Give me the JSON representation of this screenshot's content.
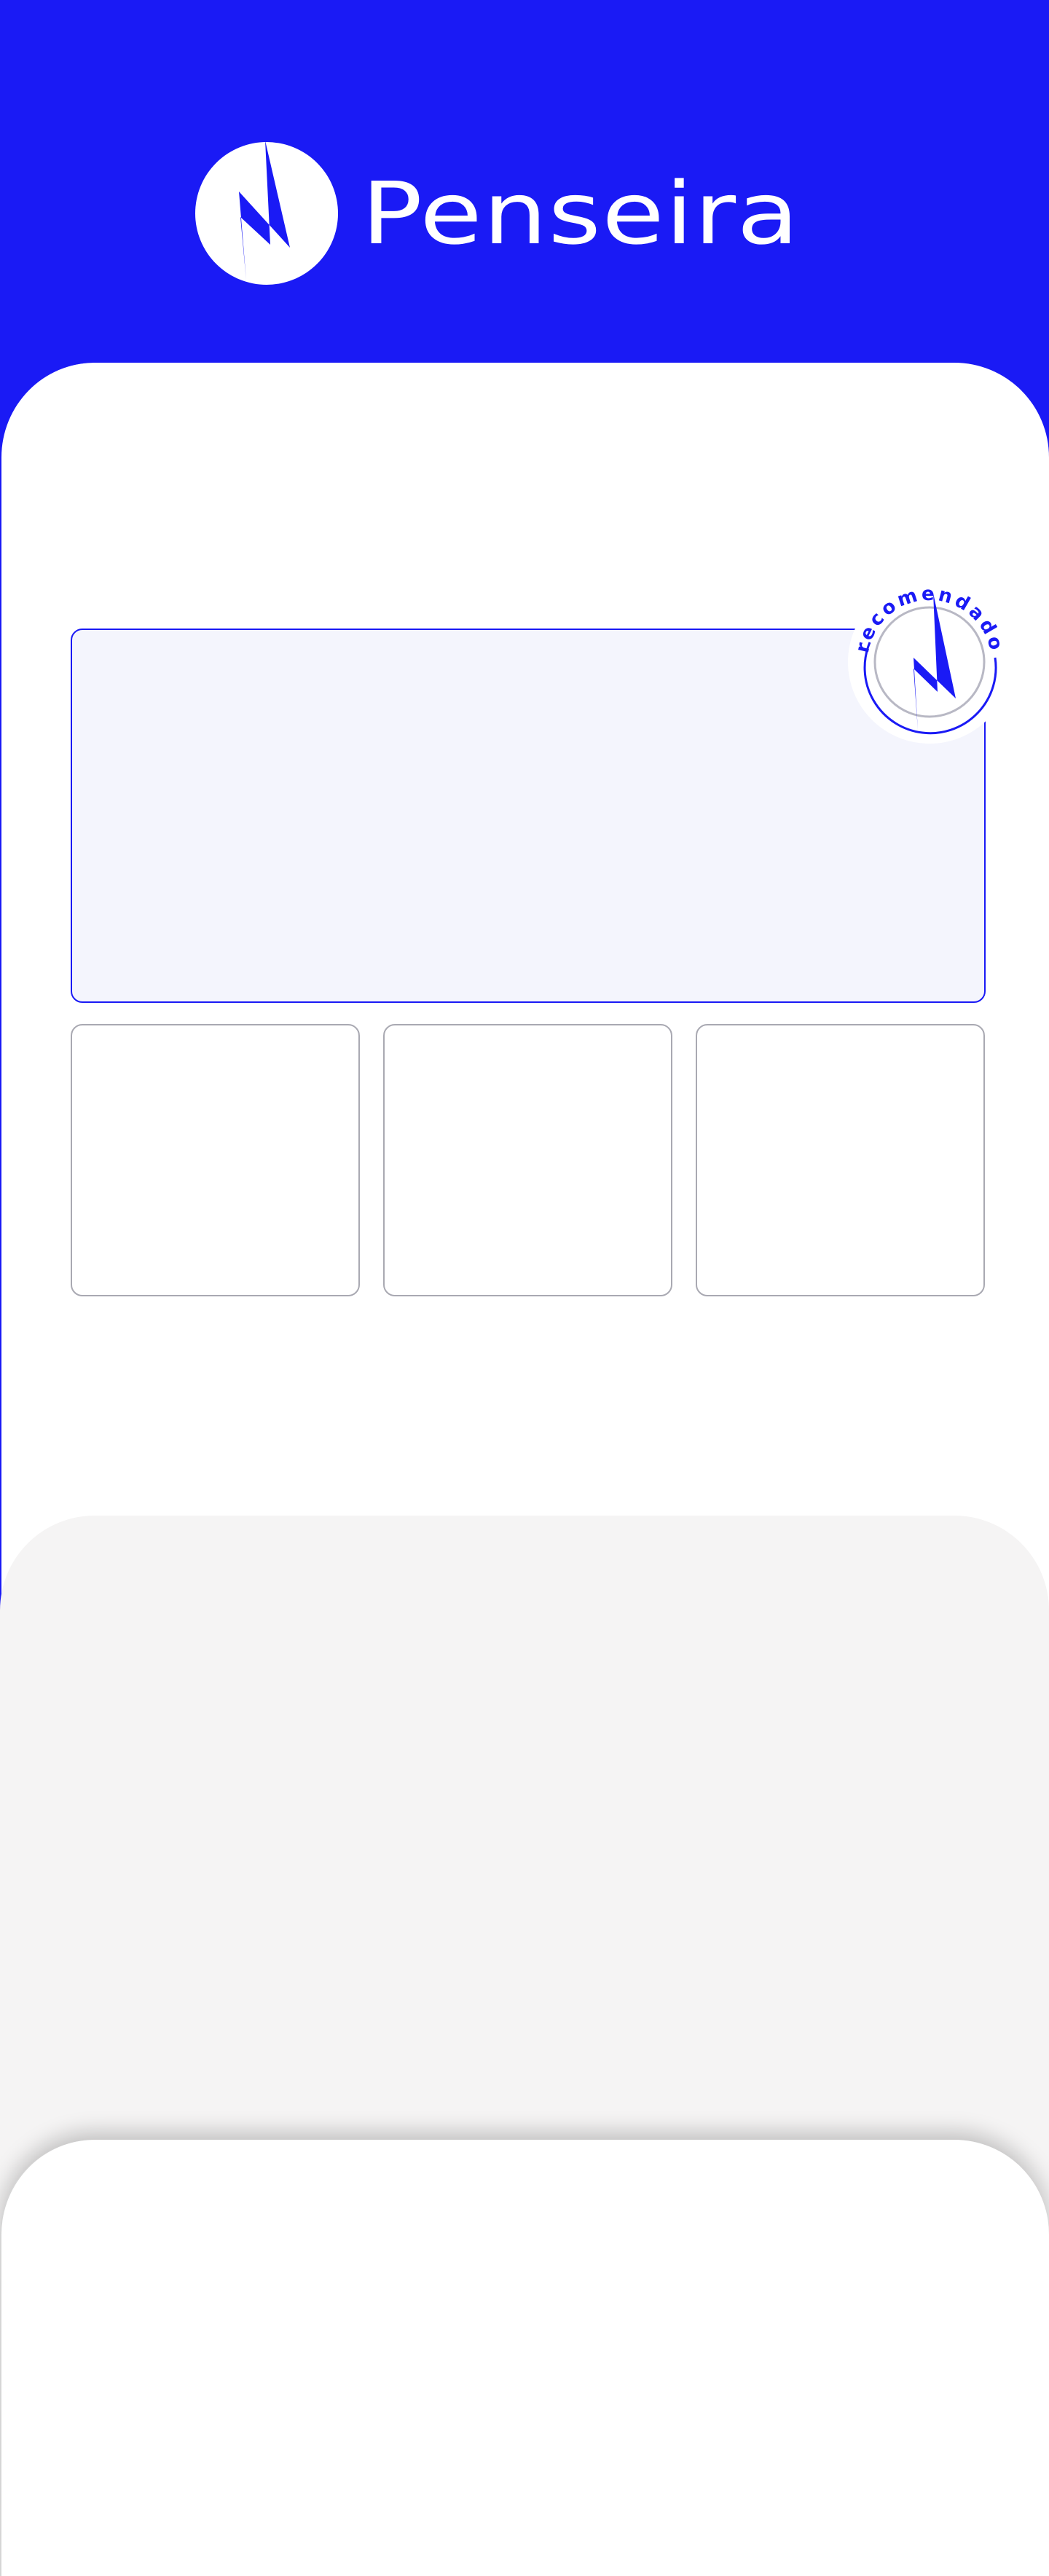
{
  "colors": {
    "brand": "#1a1af5",
    "white": "#ffffff",
    "featured_bg": "#f4f5fd",
    "card_border": "#a9a9b2",
    "section_gray": "#f5f4f4"
  },
  "header": {
    "brand_name": "Penseira",
    "logo_icon": "lightning-bolt-icon"
  },
  "recommendation_badge": {
    "label": "recomendado",
    "icon": "lightning-bolt-icon"
  }
}
